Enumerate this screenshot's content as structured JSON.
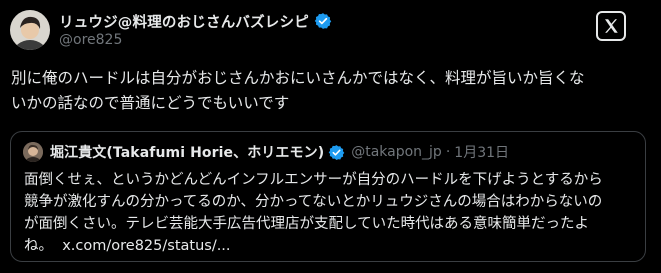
{
  "author": {
    "display_name": "リュウジ@料理のおじさんバズレシピ",
    "handle": "@ore825",
    "verified": true
  },
  "tweet": {
    "text_line1": "別に俺のハードルは自分がおじさんかおにいさんかではなく、料理が旨いか旨くな",
    "text_line2": "いかの話なので普通にどうでもいいです"
  },
  "quoted_tweet": {
    "display_name": "堀江貴文(Takafumi Horie、ホリエモン)",
    "handle": "@takapon_jp",
    "separator": "·",
    "date": "1月31日",
    "verified": true,
    "text_line1": "面倒くせぇ、というかどんどんインフルエンサーが自分のハードルを下げようとするから",
    "text_line2": "競争が激化すんの分かってるのか、分かってないとかリュウジさんの場合はわからないの",
    "text_line3": "が面倒くさい。テレビ芸能大手広告代理店が支配していた時代はある意味簡単だったよ",
    "text_line4_prefix": "ね。",
    "link_text": "x.com/ore825/status/..."
  },
  "icons": {
    "verified_badge": "verified-badge-icon",
    "x_logo": "x-logo-icon"
  },
  "colors": {
    "background": "#000000",
    "text": "#e7e9ea",
    "secondary_text": "#71767b",
    "verified_blue": "#1d9bf0",
    "quote_border": "#3a3e42"
  }
}
